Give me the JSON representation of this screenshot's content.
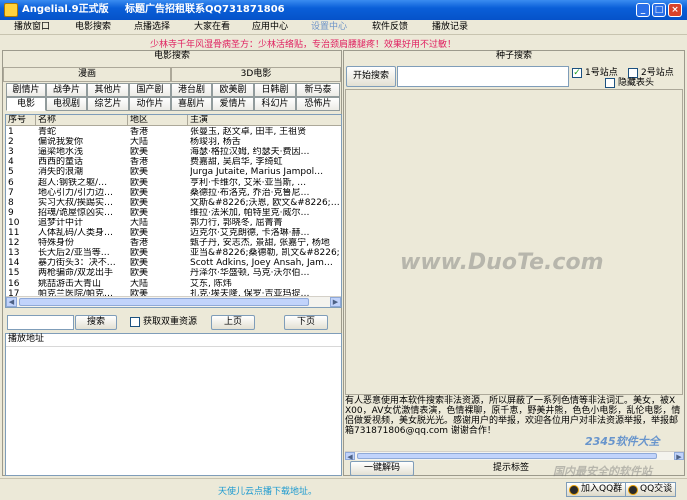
{
  "titlebar": {
    "app_title": "Angelial.9正式版",
    "ad_text": "标题广告招租联系QQ731871806",
    "min_glyph": "_",
    "max_glyph": "□",
    "close_glyph": "×"
  },
  "menu": [
    "播放窗口",
    "电影搜索",
    "点播选择",
    "大家在看",
    "应用中心",
    "设置中心",
    "软件反馈",
    "播放记录"
  ],
  "menu_active": "设置中心",
  "notice": "少林寺千年风湿骨病圣方：少林活络贴，专治颈肩腰腿疼！效果好用不过敏！",
  "search_panel": {
    "title": "电影搜索",
    "group_left": "漫画",
    "group_right": "3D电影",
    "tabs_row1": [
      "剧情片",
      "战争片",
      "其他片",
      "国产剧",
      "港台剧",
      "欧美剧",
      "日韩剧",
      "新马泰"
    ],
    "tabs_row2": [
      "电影",
      "电视剧",
      "综艺片",
      "动作片",
      "喜剧片",
      "爱情片",
      "科幻片",
      "恐怖片"
    ],
    "active_tab": "电影",
    "columns": [
      "序号",
      "名称",
      "地区",
      "主演"
    ],
    "rows": [
      [
        "1",
        "青蛇",
        "香港",
        "张曼玉, 赵文卓, 田丰, 王祖贤"
      ],
      [
        "2",
        "偏说我爱你",
        "大陆",
        "杨竣羽, 杨舌"
      ],
      [
        "3",
        "逼梁地水浅",
        "欧美",
        "海瑟·格拉汉姆, 约瑟夫·费因…"
      ],
      [
        "4",
        "西西的童话",
        "香港",
        "费嘉甜, 吴启华, 李绮虹"
      ],
      [
        "5",
        "消失的浪潮",
        "欧美",
        "Jurga Jutaite, Marius Jampol…"
      ],
      [
        "6",
        "超人:钢铁之躯/…",
        "欧美",
        "亨利·卡维尔, 艾米·亚当斯, …"
      ],
      [
        "7",
        "地心引力/引力边…",
        "欧美",
        "桑德拉·布洛克, 乔治·克鲁尼…"
      ],
      [
        "8",
        "实习大叔/挨踢实…",
        "欧美",
        "文斯&#8226;沃恩, 欧文&#8226;…"
      ],
      [
        "9",
        "招魂/诡屋惊凶实…",
        "欧美",
        "维拉·法米加, 帕特里克·威尔…"
      ],
      [
        "10",
        "追梦计中计",
        "大陆",
        "郭力行, 郭晓冬, 屈菁菁"
      ],
      [
        "11",
        "人体乱码/人类身…",
        "欧美",
        "迈克尔·艾克朗德, 卡洛琳·赫…"
      ],
      [
        "12",
        "特殊身份",
        "香港",
        "甄子丹, 安志杰, 景甜, 张嘉宁, 杨地"
      ],
      [
        "13",
        "长大后2/亚当等…",
        "欧美",
        "亚当&#8226;桑德勒, 凯文&#8226;…"
      ],
      [
        "14",
        "暴力街头3：决不…",
        "欧美",
        "Scott Adkins, Joey Ansah, Jam…"
      ],
      [
        "15",
        "两枪骗命/双龙出手",
        "欧美",
        "丹泽尔·华盛顿, 马克·沃尔伯…"
      ],
      [
        "16",
        "姚喆游击大青山",
        "大陆",
        "艾东, 陈炜"
      ],
      [
        "17",
        "帕克兰医院/帕克…",
        "欧美",
        "扎克·埃夫隆, 保罗·吉亚玛提…"
      ],
      [
        "18",
        "山林喋血",
        "大陆",
        "李树生, 张二丹, 陆影"
      ]
    ],
    "search_input_value": "",
    "search_button": "搜索",
    "get_double_label": "获取双重资源",
    "get_double_checked": false,
    "prev_button": "上页",
    "next_button": "下页",
    "play_address_label": "播放地址"
  },
  "seed_panel": {
    "title": "种子搜索",
    "start_button": "开始搜索",
    "keyword_value": "",
    "site1_label": "1号站点",
    "site1_checked": true,
    "site2_label": "2号站点",
    "site2_checked": false,
    "hide_header_label": "隐藏表头",
    "hide_header_checked": false,
    "notes": "有人恶意使用本软件搜索非法资源，所以屏蔽了一系列色情等非法词汇。美女，被XX00，AV女优激情表演，色情裸聊，原千恵，野美井熊，色色小电影，乱伦电影，情侣做爱视频，美女脱光光。感谢用户的举报，欢迎各位用户对非法资源举报，举报邮箱731871806@qq.com 谢谢合作！",
    "decode_button": "一键解码",
    "hint_label": "提示标签"
  },
  "status": {
    "footnote": "天使儿云点播下载地址。",
    "qq_group_button": "加入QQ群",
    "qq_chat_button": "QQ交谈"
  },
  "watermarks": {
    "duote": "www.DuoTe.com",
    "site2345": "2345软件大全",
    "tagline": "国内最安全的软件站"
  }
}
